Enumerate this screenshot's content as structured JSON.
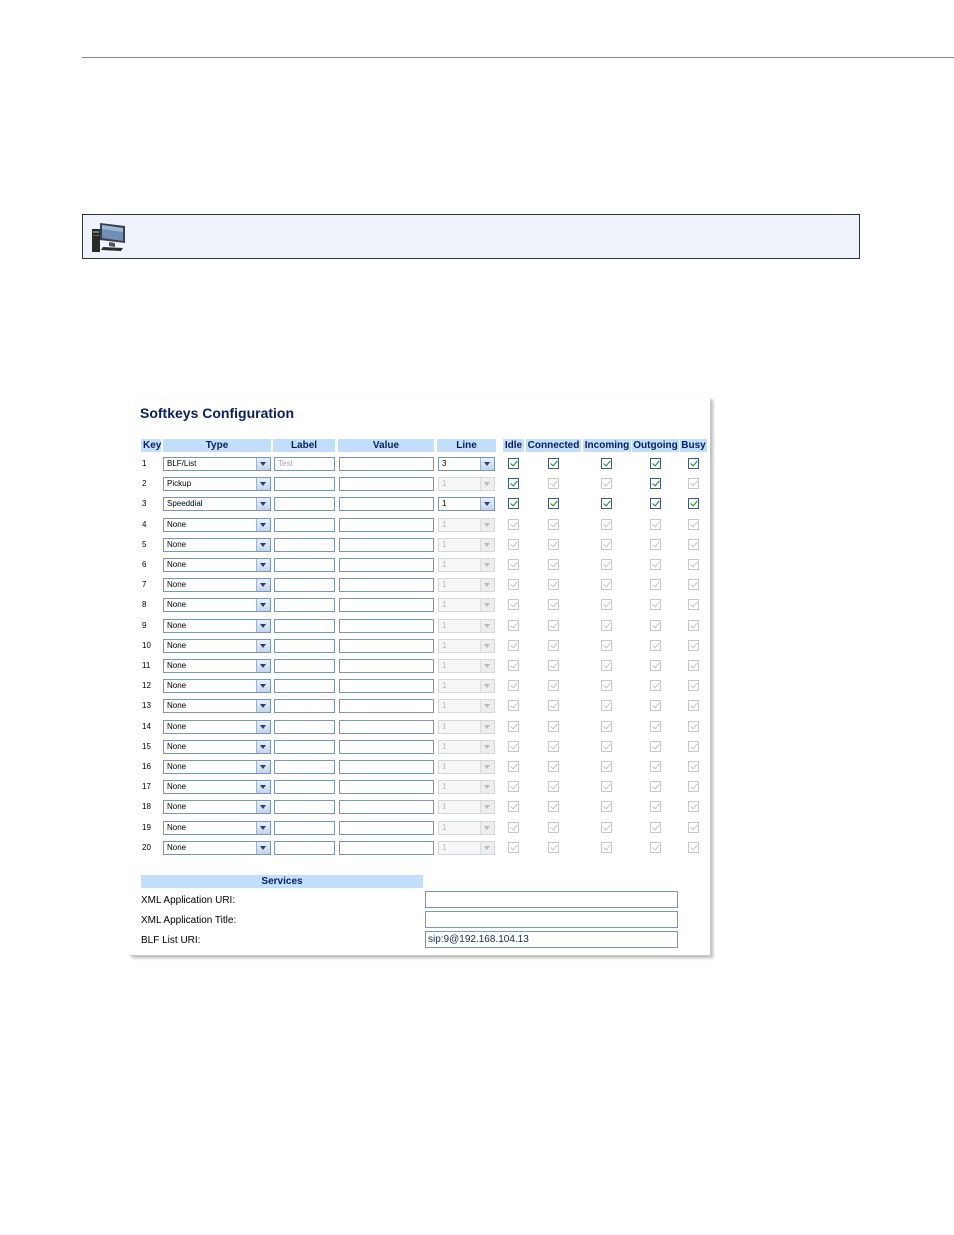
{
  "panel": {
    "title": "Softkeys Configuration",
    "headers": {
      "key": "Key",
      "type": "Type",
      "label": "Label",
      "value": "Value",
      "line": "Line",
      "idle": "Idle",
      "connected": "Connected",
      "incoming": "Incoming",
      "outgoing": "Outgoing",
      "busy": "Busy"
    },
    "rows": [
      {
        "key": "1",
        "type": "BLF/List",
        "label": "Test",
        "value": "",
        "line": "3",
        "line_enabled": true,
        "states": [
          true,
          true,
          true,
          true,
          true
        ],
        "states_enabled": [
          true,
          true,
          true,
          true,
          true
        ]
      },
      {
        "key": "2",
        "type": "Pickup",
        "label": "",
        "value": "",
        "line": "1",
        "line_enabled": false,
        "states": [
          true,
          true,
          true,
          true,
          true
        ],
        "states_enabled": [
          true,
          false,
          false,
          true,
          false
        ]
      },
      {
        "key": "3",
        "type": "Speeddial",
        "label": "",
        "value": "",
        "line": "1",
        "line_enabled": true,
        "states": [
          true,
          true,
          true,
          true,
          true
        ],
        "states_enabled": [
          true,
          true,
          true,
          true,
          true
        ]
      },
      {
        "key": "4",
        "type": "None",
        "label": "",
        "value": "",
        "line": "1",
        "line_enabled": false,
        "states": [
          true,
          true,
          true,
          true,
          true
        ],
        "states_enabled": [
          false,
          false,
          false,
          false,
          false
        ]
      },
      {
        "key": "5",
        "type": "None",
        "label": "",
        "value": "",
        "line": "1",
        "line_enabled": false,
        "states": [
          true,
          true,
          true,
          true,
          true
        ],
        "states_enabled": [
          false,
          false,
          false,
          false,
          false
        ]
      },
      {
        "key": "6",
        "type": "None",
        "label": "",
        "value": "",
        "line": "1",
        "line_enabled": false,
        "states": [
          true,
          true,
          true,
          true,
          true
        ],
        "states_enabled": [
          false,
          false,
          false,
          false,
          false
        ]
      },
      {
        "key": "7",
        "type": "None",
        "label": "",
        "value": "",
        "line": "1",
        "line_enabled": false,
        "states": [
          true,
          true,
          true,
          true,
          true
        ],
        "states_enabled": [
          false,
          false,
          false,
          false,
          false
        ]
      },
      {
        "key": "8",
        "type": "None",
        "label": "",
        "value": "",
        "line": "1",
        "line_enabled": false,
        "states": [
          true,
          true,
          true,
          true,
          true
        ],
        "states_enabled": [
          false,
          false,
          false,
          false,
          false
        ]
      },
      {
        "key": "9",
        "type": "None",
        "label": "",
        "value": "",
        "line": "1",
        "line_enabled": false,
        "states": [
          true,
          true,
          true,
          true,
          true
        ],
        "states_enabled": [
          false,
          false,
          false,
          false,
          false
        ]
      },
      {
        "key": "10",
        "type": "None",
        "label": "",
        "value": "",
        "line": "1",
        "line_enabled": false,
        "states": [
          true,
          true,
          true,
          true,
          true
        ],
        "states_enabled": [
          false,
          false,
          false,
          false,
          false
        ]
      },
      {
        "key": "11",
        "type": "None",
        "label": "",
        "value": "",
        "line": "1",
        "line_enabled": false,
        "states": [
          true,
          true,
          true,
          true,
          true
        ],
        "states_enabled": [
          false,
          false,
          false,
          false,
          false
        ]
      },
      {
        "key": "12",
        "type": "None",
        "label": "",
        "value": "",
        "line": "1",
        "line_enabled": false,
        "states": [
          true,
          true,
          true,
          true,
          true
        ],
        "states_enabled": [
          false,
          false,
          false,
          false,
          false
        ]
      },
      {
        "key": "13",
        "type": "None",
        "label": "",
        "value": "",
        "line": "1",
        "line_enabled": false,
        "states": [
          true,
          true,
          true,
          true,
          true
        ],
        "states_enabled": [
          false,
          false,
          false,
          false,
          false
        ]
      },
      {
        "key": "14",
        "type": "None",
        "label": "",
        "value": "",
        "line": "1",
        "line_enabled": false,
        "states": [
          true,
          true,
          true,
          true,
          true
        ],
        "states_enabled": [
          false,
          false,
          false,
          false,
          false
        ]
      },
      {
        "key": "15",
        "type": "None",
        "label": "",
        "value": "",
        "line": "1",
        "line_enabled": false,
        "states": [
          true,
          true,
          true,
          true,
          true
        ],
        "states_enabled": [
          false,
          false,
          false,
          false,
          false
        ]
      },
      {
        "key": "16",
        "type": "None",
        "label": "",
        "value": "",
        "line": "1",
        "line_enabled": false,
        "states": [
          true,
          true,
          true,
          true,
          true
        ],
        "states_enabled": [
          false,
          false,
          false,
          false,
          false
        ]
      },
      {
        "key": "17",
        "type": "None",
        "label": "",
        "value": "",
        "line": "1",
        "line_enabled": false,
        "states": [
          true,
          true,
          true,
          true,
          true
        ],
        "states_enabled": [
          false,
          false,
          false,
          false,
          false
        ]
      },
      {
        "key": "18",
        "type": "None",
        "label": "",
        "value": "",
        "line": "1",
        "line_enabled": false,
        "states": [
          true,
          true,
          true,
          true,
          true
        ],
        "states_enabled": [
          false,
          false,
          false,
          false,
          false
        ]
      },
      {
        "key": "19",
        "type": "None",
        "label": "",
        "value": "",
        "line": "1",
        "line_enabled": false,
        "states": [
          true,
          true,
          true,
          true,
          true
        ],
        "states_enabled": [
          false,
          false,
          false,
          false,
          false
        ]
      },
      {
        "key": "20",
        "type": "None",
        "label": "",
        "value": "",
        "line": "1",
        "line_enabled": false,
        "states": [
          true,
          true,
          true,
          true,
          true
        ],
        "states_enabled": [
          false,
          false,
          false,
          false,
          false
        ]
      }
    ]
  },
  "services": {
    "header": "Services",
    "fields": [
      {
        "label": "XML Application URI:",
        "value": ""
      },
      {
        "label": "XML Application Title:",
        "value": ""
      },
      {
        "label": "BLF List URI:",
        "value": "sip:9@192.168.104.13"
      }
    ]
  },
  "note": {
    "icon": "computer-icon"
  }
}
